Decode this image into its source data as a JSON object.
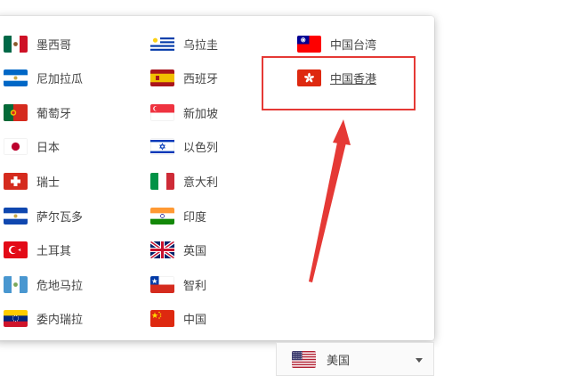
{
  "dropdown": {
    "columns": [
      [
        {
          "label": "墨西哥",
          "icon": "mexico-flag-icon"
        },
        {
          "label": "尼加拉瓜",
          "icon": "nicaragua-flag-icon"
        },
        {
          "label": "葡萄牙",
          "icon": "portugal-flag-icon"
        },
        {
          "label": "日本",
          "icon": "japan-flag-icon"
        },
        {
          "label": "瑞士",
          "icon": "switzerland-flag-icon"
        },
        {
          "label": "萨尔瓦多",
          "icon": "el-salvador-flag-icon"
        },
        {
          "label": "土耳其",
          "icon": "turkey-flag-icon"
        },
        {
          "label": "危地马拉",
          "icon": "guatemala-flag-icon"
        },
        {
          "label": "委内瑞拉",
          "icon": "venezuela-flag-icon"
        }
      ],
      [
        {
          "label": "乌拉圭",
          "icon": "uruguay-flag-icon"
        },
        {
          "label": "西班牙",
          "icon": "spain-flag-icon"
        },
        {
          "label": "新加坡",
          "icon": "singapore-flag-icon"
        },
        {
          "label": "以色列",
          "icon": "israel-flag-icon"
        },
        {
          "label": "意大利",
          "icon": "italy-flag-icon"
        },
        {
          "label": "印度",
          "icon": "india-flag-icon"
        },
        {
          "label": "英国",
          "icon": "uk-flag-icon"
        },
        {
          "label": "智利",
          "icon": "chile-flag-icon"
        },
        {
          "label": "中国",
          "icon": "china-flag-icon"
        }
      ],
      [
        {
          "label": "中国台湾",
          "icon": "taiwan-flag-icon"
        },
        {
          "label": "中国香港",
          "icon": "hong-kong-flag-icon",
          "selected": true
        }
      ]
    ]
  },
  "select": {
    "value": "美国",
    "icon": "usa-flag-icon"
  },
  "annotation": {
    "color": "#e53935"
  }
}
